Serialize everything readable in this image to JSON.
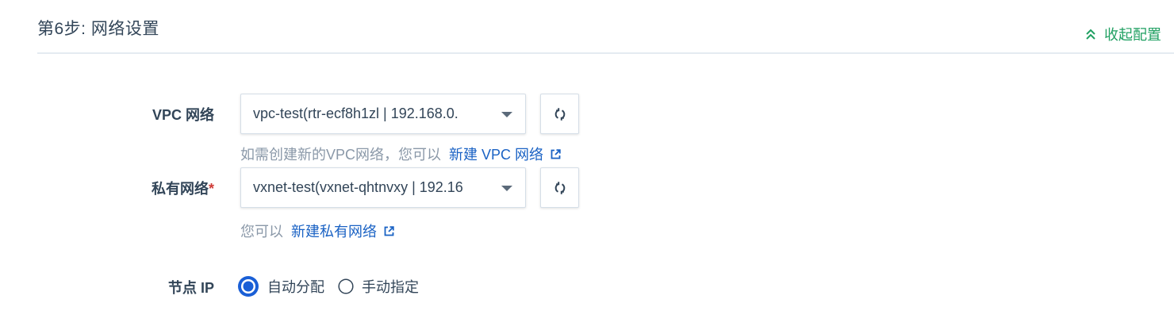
{
  "header": {
    "step_title": "第6步: 网络设置",
    "collapse_label": "收起配置"
  },
  "vpc": {
    "label": "VPC 网络",
    "selected_value": "vpc-test(rtr-ecf8h1zl | 192.168.0.",
    "help_text": "如需创建新的VPC网络，您可以",
    "help_link": "新建 VPC 网络"
  },
  "vxnet": {
    "label": "私有网络",
    "required_mark": "*",
    "selected_value": "vxnet-test(vxnet-qhtnvxy | 192.16",
    "help_text": "您可以",
    "help_link": "新建私有网络"
  },
  "node_ip": {
    "label": "节点 IP",
    "options": [
      {
        "label": "自动分配",
        "checked": true
      },
      {
        "label": "手动指定",
        "checked": false
      }
    ]
  },
  "colors": {
    "accent_green": "#20a062",
    "link_blue": "#1a62c4",
    "radio_blue": "#1a5fd6",
    "required_red": "#cf3b37"
  },
  "icons": {
    "collapse": "double-chevron-up-icon",
    "refresh": "refresh-icon",
    "external_link": "external-link-icon",
    "dropdown": "caret-down-icon"
  }
}
